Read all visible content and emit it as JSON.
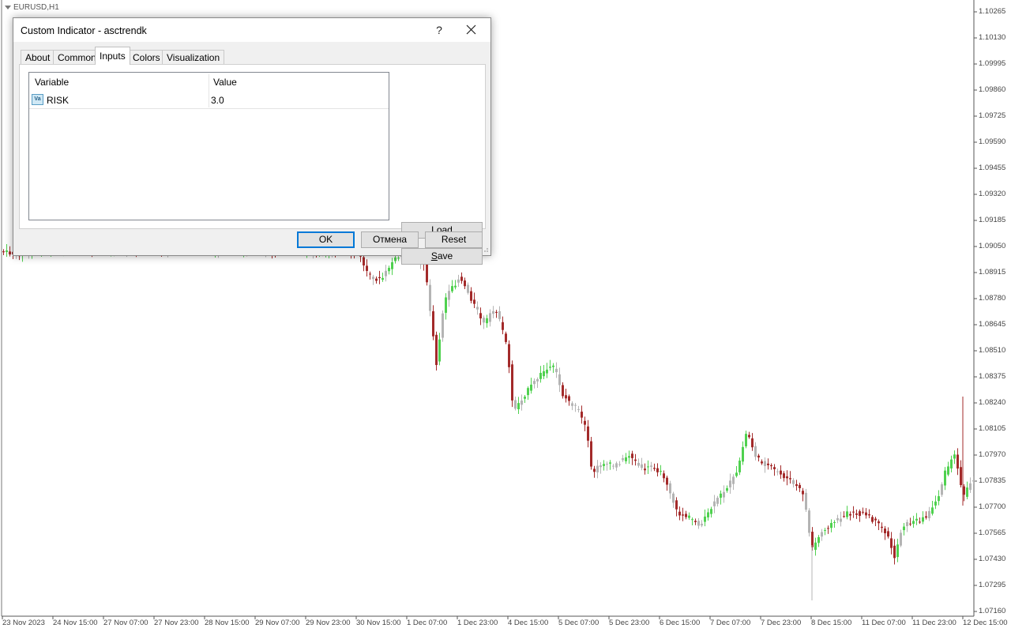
{
  "chart": {
    "symbol": "EURUSD,H1",
    "price_labels": [
      "1.10265",
      "1.10130",
      "1.09995",
      "1.09860",
      "1.09725",
      "1.09590",
      "1.09455",
      "1.09320",
      "1.09185",
      "1.09050",
      "1.08915",
      "1.08780",
      "1.08645",
      "1.08510",
      "1.08375",
      "1.08240",
      "1.08105",
      "1.07970",
      "1.07835",
      "1.07700",
      "1.07565",
      "1.07430",
      "1.07295",
      "1.07160"
    ],
    "time_labels": [
      "23 Nov 2023",
      "24 Nov 15:00",
      "27 Nov 07:00",
      "27 Nov 23:00",
      "28 Nov 15:00",
      "29 Nov 07:00",
      "29 Nov 23:00",
      "30 Nov 15:00",
      "1 Dec 07:00",
      "1 Dec 23:00",
      "4 Dec 15:00",
      "5 Dec 07:00",
      "5 Dec 23:00",
      "6 Dec 15:00",
      "7 Dec 07:00",
      "7 Dec 23:00",
      "8 Dec 15:00",
      "11 Dec 07:00",
      "11 Dec 23:00",
      "12 Dec 15:00"
    ],
    "colors": {
      "bull": "#4fd14f",
      "bear": "#a32a2a",
      "neutral": "#b4b4b4",
      "axis": "#555555"
    }
  },
  "dialog": {
    "title": "Custom Indicator - asctrendk",
    "help_label": "?",
    "tabs": [
      {
        "label": "About",
        "active": false
      },
      {
        "label": "Common",
        "active": false
      },
      {
        "label": "Inputs",
        "active": true
      },
      {
        "label": "Colors",
        "active": false
      },
      {
        "label": "Visualization",
        "active": false
      }
    ],
    "table": {
      "headers": {
        "variable": "Variable",
        "value": "Value"
      },
      "rows": [
        {
          "icon": "variable-icon",
          "icon_text": "Va",
          "variable": "RISK",
          "value": "3.0"
        }
      ]
    },
    "buttons": {
      "load": {
        "mnemonic": "L",
        "rest": "oad"
      },
      "save": {
        "mnemonic": "S",
        "rest": "ave"
      },
      "ok": "OK",
      "cancel": "Отмена",
      "reset": "Reset"
    }
  }
}
